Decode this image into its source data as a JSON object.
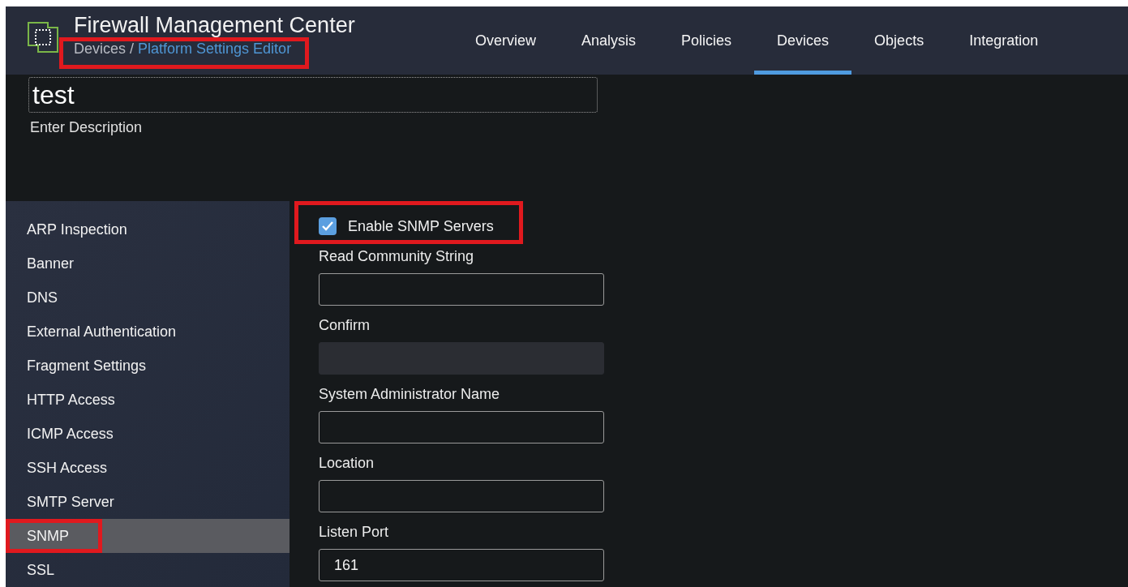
{
  "header": {
    "title": "Firewall Management Center",
    "breadcrumb": {
      "parent": "Devices",
      "separator": "/",
      "current": "Platform Settings Editor",
      "highlighted": true
    },
    "nav": [
      {
        "label": "Overview",
        "selected": false
      },
      {
        "label": "Analysis",
        "selected": false
      },
      {
        "label": "Policies",
        "selected": false
      },
      {
        "label": "Devices",
        "selected": true
      },
      {
        "label": "Objects",
        "selected": false
      },
      {
        "label": "Integration",
        "selected": false
      }
    ]
  },
  "policy": {
    "name": "test",
    "description_placeholder": "Enter Description"
  },
  "sidebar": {
    "items": [
      {
        "label": "ARP Inspection",
        "selected": false
      },
      {
        "label": "Banner",
        "selected": false
      },
      {
        "label": "DNS",
        "selected": false
      },
      {
        "label": "External Authentication",
        "selected": false
      },
      {
        "label": "Fragment Settings",
        "selected": false
      },
      {
        "label": "HTTP Access",
        "selected": false
      },
      {
        "label": "ICMP Access",
        "selected": false
      },
      {
        "label": "SSH Access",
        "selected": false
      },
      {
        "label": "SMTP Server",
        "selected": false
      },
      {
        "label": "SNMP",
        "selected": true,
        "highlighted": true
      },
      {
        "label": "SSL",
        "selected": false
      }
    ]
  },
  "form": {
    "enable": {
      "label": "Enable SNMP Servers",
      "checked": true,
      "highlighted": true
    },
    "fields": [
      {
        "label": "Read Community String",
        "disabled": false
      },
      {
        "label": "Confirm",
        "disabled": true
      },
      {
        "label": "System Administrator Name",
        "disabled": false
      },
      {
        "label": "Location",
        "disabled": false
      },
      {
        "label": "Listen Port",
        "value": "161",
        "disabled": false
      }
    ]
  }
}
